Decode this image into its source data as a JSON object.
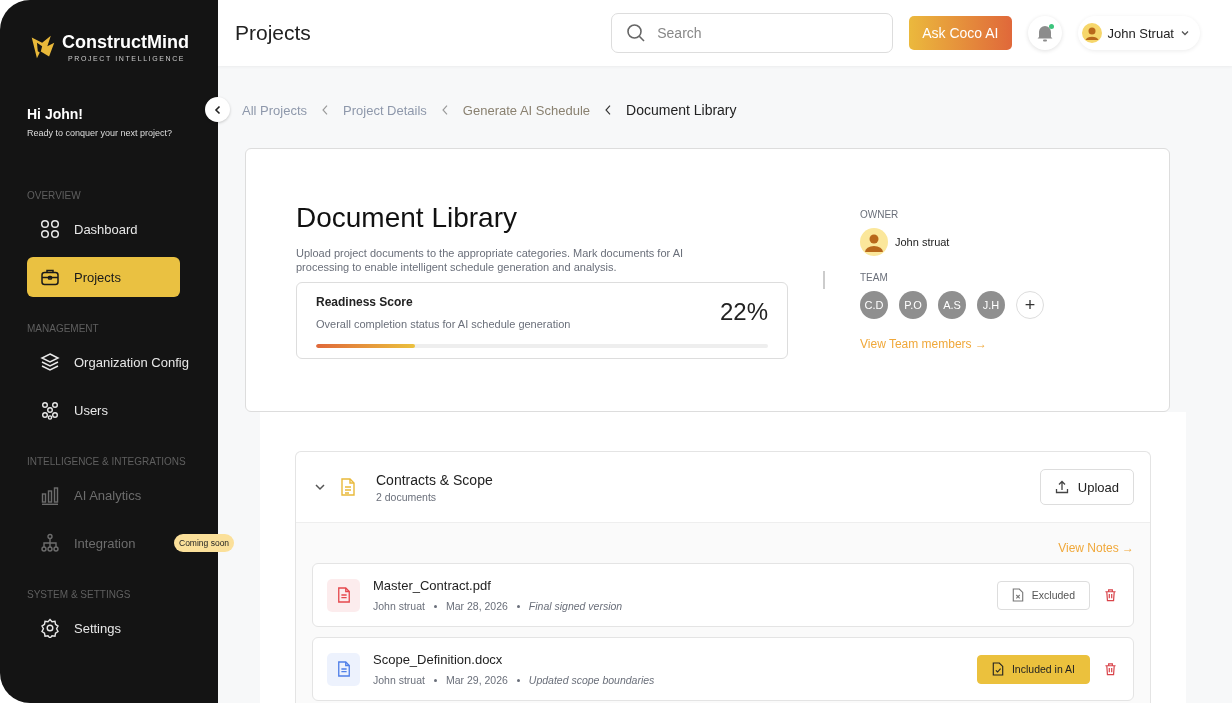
{
  "brand": {
    "name": "ConstructMind",
    "tagline": "PROJECT INTELLIGENCE"
  },
  "greeting": {
    "title": "Hi John!",
    "subtitle": "Ready to conquer your next project?"
  },
  "nav": [
    {
      "heading": "OVERVIEW",
      "items": [
        {
          "label": "Dashboard",
          "selected": false,
          "disabled": false
        },
        {
          "label": "Projects",
          "selected": true,
          "disabled": false
        }
      ]
    },
    {
      "heading": "MANAGEMENT",
      "items": [
        {
          "label": "Organization Config",
          "selected": false,
          "disabled": false
        },
        {
          "label": "Users",
          "selected": false,
          "disabled": false
        }
      ]
    },
    {
      "heading": "INTELLIGENCE & INTEGRATIONS",
      "items": [
        {
          "label": "AI Analytics",
          "selected": false,
          "disabled": true
        },
        {
          "label": "Integration",
          "selected": false,
          "disabled": true,
          "badge": "Coming soon"
        }
      ]
    },
    {
      "heading": "SYSTEM & SETTINGS",
      "items": [
        {
          "label": "Settings",
          "selected": false,
          "disabled": false
        }
      ]
    }
  ],
  "header": {
    "title": "Projects",
    "search": {
      "placeholder": "Search"
    },
    "ask_button": "Ask Coco AI",
    "notification_unread": true,
    "user": "John Struat"
  },
  "breadcrumbs": [
    {
      "label": "All Projects",
      "current": false
    },
    {
      "label": "Project Details",
      "current": false
    },
    {
      "label": "Generate AI Schedule",
      "current": false
    },
    {
      "label": "Document Library",
      "current": true
    }
  ],
  "library": {
    "title": "Document Library",
    "description": "Upload project documents to the appropriate categories. Mark documents for AI processing to enable intelligent schedule generation and analysis.",
    "readiness": {
      "title": "Readiness Score",
      "subtitle": "Overall completion status for AI schedule generation",
      "value": "22%",
      "level": 0.22
    },
    "owner": {
      "label": "OWNER",
      "name": "John struat"
    },
    "team": {
      "label": "TEAM",
      "members": [
        "C.D",
        "P.O",
        "A.S",
        "J.H"
      ],
      "add": "+",
      "link": "View Team members →"
    }
  },
  "section": {
    "title": "Contracts & Scope",
    "count": "2 documents",
    "expanded": true,
    "upload": "Upload",
    "notes_link": "View Notes →",
    "documents": [
      {
        "name": "Master_Contract.pdf",
        "color": "#e5484d",
        "author": "John struat",
        "date": "Mar 28, 2026",
        "note": "Final signed version",
        "included": false,
        "status": "Excluded"
      },
      {
        "name": "Scope_Definition.docx",
        "color": "#4f7fe8",
        "author": "John struat",
        "date": "Mar 29, 2026",
        "note": "Updated scope boundaries",
        "included": true,
        "status": "Included in AI"
      }
    ]
  }
}
